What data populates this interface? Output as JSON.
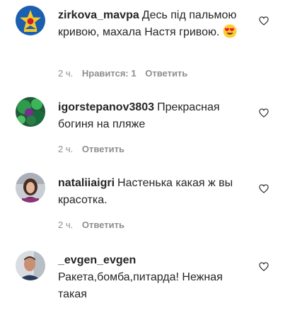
{
  "comments": [
    {
      "username": "zirkova_mavpa",
      "text": "Десь під пальмою кривою, махала Настя гривою.",
      "emoji": "heart-eyes-emoji",
      "time": "2 ч.",
      "likes": "Нравится: 1",
      "reply": "Ответить"
    },
    {
      "username": "igorstepanov3803",
      "text": "Прекрасная богиня на пляже",
      "time": "2 ч.",
      "reply": "Ответить"
    },
    {
      "username": "nataliiaigri",
      "text": "Настенька какая ж вы красотка.",
      "time": "2 ч.",
      "reply": "Ответить"
    },
    {
      "username": "_evgen_evgen",
      "text": "Ракета,бомба,питарда! Нежная такая",
      "reply": ""
    }
  ],
  "icons": {
    "like": "heart-outline-icon"
  },
  "colors": {
    "text": "#262626",
    "meta": "#8e8e8e",
    "avatar1_bg": "#1b5fb0",
    "avatar1_star": "#f4c92a"
  }
}
